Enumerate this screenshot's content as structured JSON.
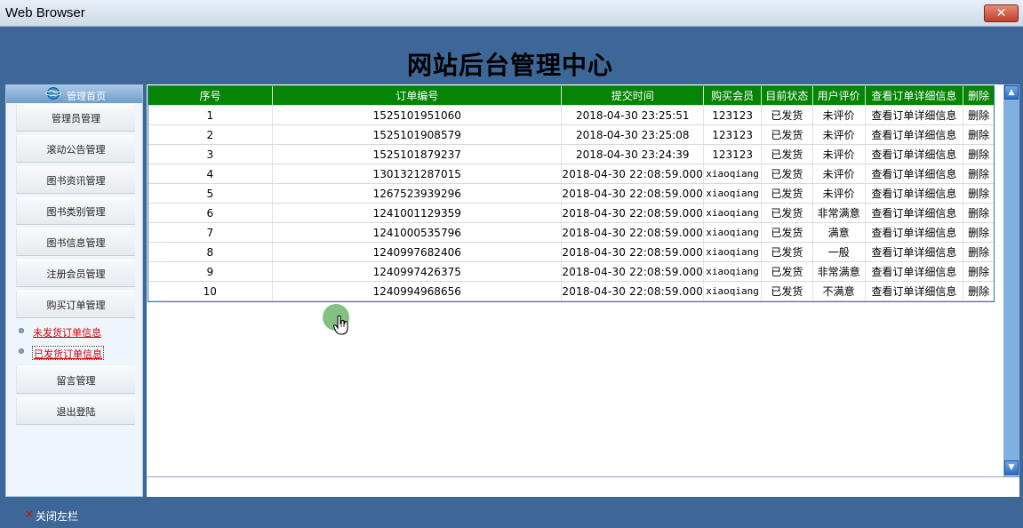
{
  "window": {
    "title": "Web Browser",
    "close_glyph": "✕"
  },
  "header": {
    "title": "网站后台管理中心"
  },
  "sidebar": {
    "home_label": "管理首页",
    "home_icon": "globe-icon",
    "items": [
      "管理员管理",
      "滚动公告管理",
      "图书资讯管理",
      "图书类别管理",
      "图书信息管理",
      "注册会员管理",
      "购买订单管理"
    ],
    "sub_items": [
      "未发货订单信息",
      "已发货订单信息"
    ],
    "items_after": [
      "留言管理",
      "退出登陆"
    ]
  },
  "table": {
    "headers": [
      "序号",
      "订单编号",
      "提交时间",
      "购买会员",
      "目前状态",
      "用户评价",
      "查看订单详细信息",
      "删除"
    ],
    "rows": [
      [
        "1",
        "1525101951060",
        "2018-04-30 23:25:51",
        "123123",
        "已发货",
        "未评价",
        "查看订单详细信息",
        "删除"
      ],
      [
        "2",
        "1525101908579",
        "2018-04-30 23:25:08",
        "123123",
        "已发货",
        "未评价",
        "查看订单详细信息",
        "删除"
      ],
      [
        "3",
        "1525101879237",
        "2018-04-30 23:24:39",
        "123123",
        "已发货",
        "未评价",
        "查看订单详细信息",
        "删除"
      ],
      [
        "4",
        "1301321287015",
        "2018-04-30 22:08:59.000",
        "xiaoqiang",
        "已发货",
        "未评价",
        "查看订单详细信息",
        "删除"
      ],
      [
        "5",
        "1267523939296",
        "2018-04-30 22:08:59.000",
        "xiaoqiang",
        "已发货",
        "未评价",
        "查看订单详细信息",
        "删除"
      ],
      [
        "6",
        "1241001129359",
        "2018-04-30 22:08:59.000",
        "xiaoqiang",
        "已发货",
        "非常满意",
        "查看订单详细信息",
        "删除"
      ],
      [
        "7",
        "1241000535796",
        "2018-04-30 22:08:59.000",
        "xiaoqiang",
        "已发货",
        "满意",
        "查看订单详细信息",
        "删除"
      ],
      [
        "8",
        "1240997682406",
        "2018-04-30 22:08:59.000",
        "xiaoqiang",
        "已发货",
        "一般",
        "查看订单详细信息",
        "删除"
      ],
      [
        "9",
        "1240997426375",
        "2018-04-30 22:08:59.000",
        "xiaoqiang",
        "已发货",
        "非常满意",
        "查看订单详细信息",
        "删除"
      ],
      [
        "10",
        "1240994968656",
        "2018-04-30 22:08:59.000",
        "xiaoqiang",
        "已发货",
        "不满意",
        "查看订单详细信息",
        "删除"
      ]
    ]
  },
  "scrollbar": {
    "up_glyph": "▲",
    "down_glyph": "▼"
  },
  "footer": {
    "close_glyph": "×",
    "label": "关闭左栏"
  },
  "colors": {
    "header_bg": "#3c6797",
    "table_header_bg": "#058405",
    "link_red": "#d40000"
  }
}
